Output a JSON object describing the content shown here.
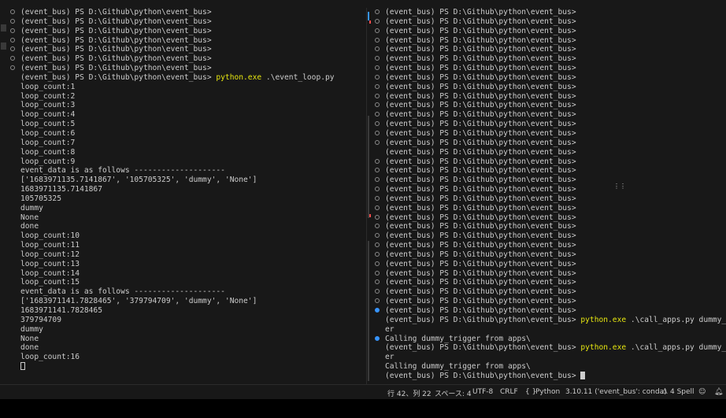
{
  "left_terminal": {
    "lines": [
      {
        "text": "(event_bus) PS D:\\Github\\python\\event_bus>",
        "deco": "circle"
      },
      {
        "text": "(event_bus) PS D:\\Github\\python\\event_bus>",
        "deco": "circle"
      },
      {
        "text": "(event_bus) PS D:\\Github\\python\\event_bus>",
        "deco": "circle"
      },
      {
        "text": "(event_bus) PS D:\\Github\\python\\event_bus>",
        "deco": "circle"
      },
      {
        "text": "(event_bus) PS D:\\Github\\python\\event_bus>",
        "deco": "circle"
      },
      {
        "text": "(event_bus) PS D:\\Github\\python\\event_bus>",
        "deco": "circle"
      },
      {
        "text": "(event_bus) PS D:\\Github\\python\\event_bus>",
        "deco": "circle"
      },
      {
        "text": "(event_bus) PS D:\\Github\\python\\event_bus>",
        "deco": "",
        "cmd": " python.exe",
        "rest": " .\\event_loop.py"
      },
      {
        "text": "loop_count:1"
      },
      {
        "text": "loop_count:2"
      },
      {
        "text": "loop_count:3"
      },
      {
        "text": "loop_count:4"
      },
      {
        "text": "loop_count:5"
      },
      {
        "text": "loop_count:6"
      },
      {
        "text": "loop_count:7"
      },
      {
        "text": "loop_count:8"
      },
      {
        "text": "loop_count:9"
      },
      {
        "text": "event_data is as follows --------------------"
      },
      {
        "text": "['1683971135.7141867', '105705325', 'dummy', 'None']"
      },
      {
        "text": "1683971135.7141867"
      },
      {
        "text": "105705325"
      },
      {
        "text": "dummy"
      },
      {
        "text": "None"
      },
      {
        "text": "done"
      },
      {
        "text": "loop_count:10"
      },
      {
        "text": "loop_count:11"
      },
      {
        "text": "loop_count:12"
      },
      {
        "text": "loop_count:13"
      },
      {
        "text": "loop_count:14"
      },
      {
        "text": "loop_count:15"
      },
      {
        "text": "event_data is as follows --------------------"
      },
      {
        "text": "['1683971141.7828465', '379794709', 'dummy', 'None']"
      },
      {
        "text": "1683971141.7828465"
      },
      {
        "text": "379794709"
      },
      {
        "text": "dummy"
      },
      {
        "text": "None"
      },
      {
        "text": "done"
      },
      {
        "text": "loop_count:16"
      },
      {
        "text": "",
        "cursor": "hollow"
      }
    ]
  },
  "right_terminal": {
    "lines": [
      {
        "text": "(event_bus) PS D:\\Github\\python\\event_bus>",
        "deco": "circle"
      },
      {
        "text": "(event_bus) PS D:\\Github\\python\\event_bus>",
        "deco": "circle"
      },
      {
        "text": "(event_bus) PS D:\\Github\\python\\event_bus>",
        "deco": "circle"
      },
      {
        "text": "(event_bus) PS D:\\Github\\python\\event_bus>",
        "deco": "circle"
      },
      {
        "text": "(event_bus) PS D:\\Github\\python\\event_bus>",
        "deco": "circle"
      },
      {
        "text": "(event_bus) PS D:\\Github\\python\\event_bus>",
        "deco": "circle"
      },
      {
        "text": "(event_bus) PS D:\\Github\\python\\event_bus>",
        "deco": "circle"
      },
      {
        "text": "(event_bus) PS D:\\Github\\python\\event_bus>",
        "deco": "circle"
      },
      {
        "text": "(event_bus) PS D:\\Github\\python\\event_bus>",
        "deco": "circle"
      },
      {
        "text": "(event_bus) PS D:\\Github\\python\\event_bus>",
        "deco": "circle"
      },
      {
        "text": "(event_bus) PS D:\\Github\\python\\event_bus>",
        "deco": "circle"
      },
      {
        "text": "(event_bus) PS D:\\Github\\python\\event_bus>",
        "deco": "circle"
      },
      {
        "text": "(event_bus) PS D:\\Github\\python\\event_bus>",
        "deco": "circle"
      },
      {
        "text": "(event_bus) PS D:\\Github\\python\\event_bus>",
        "deco": "circle"
      },
      {
        "text": "(event_bus) PS D:\\Github\\python\\event_bus>",
        "deco": "circle"
      },
      {
        "text": "(event_bus) PS D:\\Github\\python\\event_bus>",
        "deco": ""
      },
      {
        "text": "(event_bus) PS D:\\Github\\python\\event_bus>",
        "deco": "circle"
      },
      {
        "text": "(event_bus) PS D:\\Github\\python\\event_bus>",
        "deco": "circle"
      },
      {
        "text": "(event_bus) PS D:\\Github\\python\\event_bus>",
        "deco": "circle"
      },
      {
        "text": "(event_bus) PS D:\\Github\\python\\event_bus>",
        "deco": "circle"
      },
      {
        "text": "(event_bus) PS D:\\Github\\python\\event_bus>",
        "deco": "circle"
      },
      {
        "text": "(event_bus) PS D:\\Github\\python\\event_bus>",
        "deco": "circle"
      },
      {
        "text": "(event_bus) PS D:\\Github\\python\\event_bus>",
        "deco": "circle"
      },
      {
        "text": "(event_bus) PS D:\\Github\\python\\event_bus>",
        "deco": "circle"
      },
      {
        "text": "(event_bus) PS D:\\Github\\python\\event_bus>",
        "deco": "circle"
      },
      {
        "text": "(event_bus) PS D:\\Github\\python\\event_bus>",
        "deco": "circle"
      },
      {
        "text": "(event_bus) PS D:\\Github\\python\\event_bus>",
        "deco": "circle"
      },
      {
        "text": "(event_bus) PS D:\\Github\\python\\event_bus>",
        "deco": "circle"
      },
      {
        "text": "(event_bus) PS D:\\Github\\python\\event_bus>",
        "deco": "circle"
      },
      {
        "text": "(event_bus) PS D:\\Github\\python\\event_bus>",
        "deco": "circle"
      },
      {
        "text": "(event_bus) PS D:\\Github\\python\\event_bus>",
        "deco": "circle"
      },
      {
        "text": "(event_bus) PS D:\\Github\\python\\event_bus>",
        "deco": "circle"
      },
      {
        "text": "(event_bus) PS D:\\Github\\python\\event_bus>",
        "deco": "blue"
      },
      {
        "text": "(event_bus) PS D:\\Github\\python\\event_bus>",
        "deco": "",
        "cmd": " python.exe",
        "rest": " .\\call_apps.py dummy_trigg"
      },
      {
        "text": "er"
      },
      {
        "text": "Calling dummy_trigger from apps\\",
        "deco": "blue"
      },
      {
        "text": "(event_bus) PS D:\\Github\\python\\event_bus>",
        "deco": "",
        "cmd": " python.exe",
        "rest": " .\\call_apps.py dummy_trigg"
      },
      {
        "text": "er"
      },
      {
        "text": "Calling dummy_trigger from apps\\"
      },
      {
        "text": "(event_bus) PS D:\\Github\\python\\event_bus> ",
        "cursor": "solid"
      }
    ]
  },
  "statusbar": {
    "position": "行 42、列 22",
    "spaces": "スペース: 4",
    "encoding": "UTF-8",
    "eol": "CRLF",
    "language": "Python",
    "interpreter": "3.10.11 ('event_bus': conda)",
    "spell": "4 Spell",
    "icons": {
      "braces": "braces-icon",
      "spell": "spell-icon",
      "feedback": "feedback-icon",
      "bell": "bell-icon"
    }
  }
}
